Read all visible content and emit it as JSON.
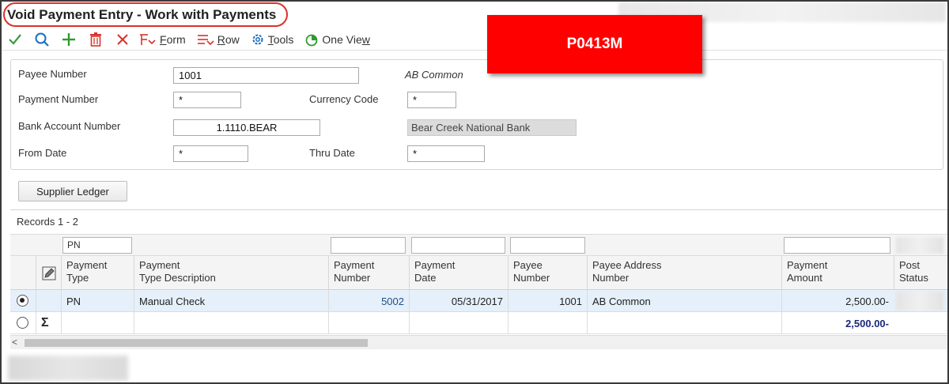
{
  "window": {
    "title": "Void Payment Entry - Work with Payments"
  },
  "badge": {
    "text": "P0413M"
  },
  "toolbar": {
    "form_label": "Form",
    "row_label": "Row",
    "tools_label": "Tools",
    "oneview_label": "One View",
    "icons": [
      "check-icon",
      "search-icon",
      "add-icon",
      "delete-icon",
      "close-icon",
      "form-icon",
      "row-icon",
      "gear-icon",
      "chart-icon"
    ],
    "colors": {
      "check": "#3a9a3a",
      "search": "#1a6fc0",
      "add": "#2e9b2e",
      "delete": "#d9322c",
      "close": "#d9322c"
    }
  },
  "filters": {
    "payee_number": {
      "label": "Payee Number",
      "value": "1001",
      "desc": "AB Common"
    },
    "payment_number": {
      "label": "Payment Number",
      "value": "*"
    },
    "currency_code": {
      "label": "Currency Code",
      "value": "*"
    },
    "bank_account": {
      "label": "Bank Account Number",
      "value": "1.1110.BEAR",
      "desc": "Bear Creek National Bank"
    },
    "from_date": {
      "label": "From Date",
      "value": "*"
    },
    "thru_date": {
      "label": "Thru Date",
      "value": "*"
    }
  },
  "buttons": {
    "supplier_ledger": "Supplier Ledger"
  },
  "grid": {
    "records_label": "Records 1 - 2",
    "qbe": {
      "payment_type": "PN"
    },
    "headers": {
      "payment_type": [
        "Payment",
        "Type"
      ],
      "type_desc": [
        "Payment",
        "Type Description"
      ],
      "payment_number": [
        "Payment",
        "Number"
      ],
      "payment_date": [
        "Payment",
        "Date"
      ],
      "payee_number": [
        "Payee",
        "Number"
      ],
      "payee_address": [
        "Payee Address",
        "Number"
      ],
      "payment_amount": [
        "Payment",
        "Amount"
      ],
      "post_status": [
        "Post",
        "Status"
      ]
    },
    "rows": [
      {
        "payment_type": "PN",
        "type_desc": "Manual Check",
        "payment_number": "5002",
        "payment_date": "05/31/2017",
        "payee_number": "1001",
        "payee_address": "AB Common",
        "payment_amount": "2,500.00-"
      }
    ],
    "total": {
      "symbol": "Σ",
      "payment_amount": "2,500.00-"
    }
  }
}
